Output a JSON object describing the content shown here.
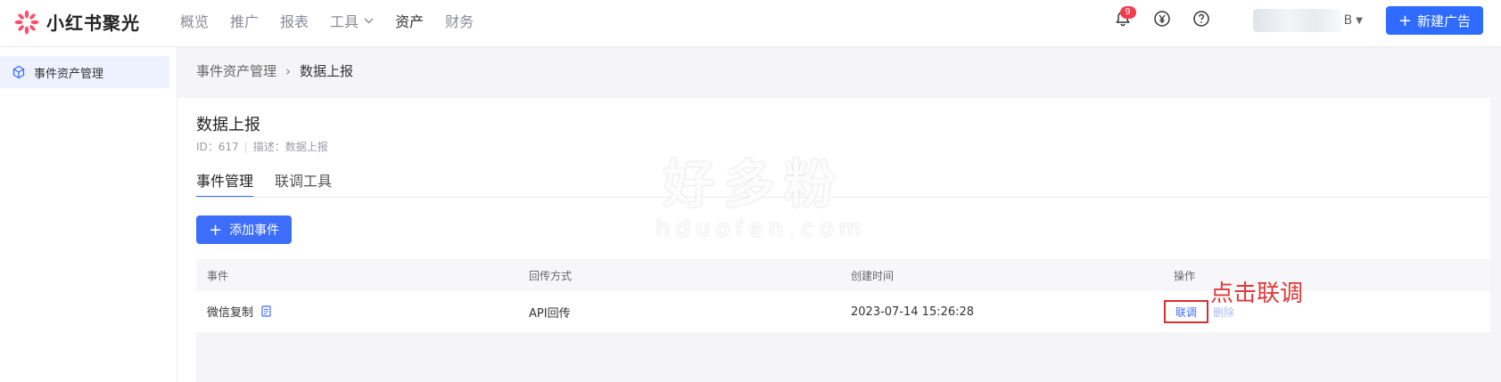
{
  "brand": {
    "name": "小红书聚光",
    "accent_color": "#2f6bff",
    "logo_color": "#ff4d6a"
  },
  "nav": {
    "items": [
      {
        "label": "概览"
      },
      {
        "label": "推广"
      },
      {
        "label": "报表"
      },
      {
        "label": "工具"
      },
      {
        "label": "资产"
      },
      {
        "label": "财务"
      }
    ]
  },
  "header": {
    "notification_count": "9",
    "account_suffix": "B",
    "new_ad_label": "新建广告",
    "icons": [
      "bell-icon",
      "yen-icon",
      "help-icon"
    ]
  },
  "sidebar": {
    "items": [
      {
        "label": "事件资产管理",
        "icon": "cube-icon"
      }
    ]
  },
  "breadcrumb": {
    "parent": "事件资产管理",
    "separator": "›",
    "current": "数据上报"
  },
  "asset": {
    "title": "数据上报",
    "id_text": "ID：617",
    "desc_text": "描述：数据上报"
  },
  "tabs": [
    {
      "label": "事件管理",
      "active": true
    },
    {
      "label": "联调工具",
      "active": false
    }
  ],
  "actions": {
    "add_event_label": "添加事件"
  },
  "table": {
    "columns": [
      "事件",
      "回传方式",
      "创建时间",
      "操作"
    ],
    "rows": [
      {
        "event": "微信复制",
        "method": "API回传",
        "created_at": "2023-07-14 15:26:28",
        "op_debug": "联调",
        "op_delete": "删除"
      }
    ]
  },
  "annotation": {
    "text": "点击联调",
    "color": "#e03a3a"
  },
  "watermark": {
    "big": "好多粉",
    "small": "hduofen.com"
  }
}
